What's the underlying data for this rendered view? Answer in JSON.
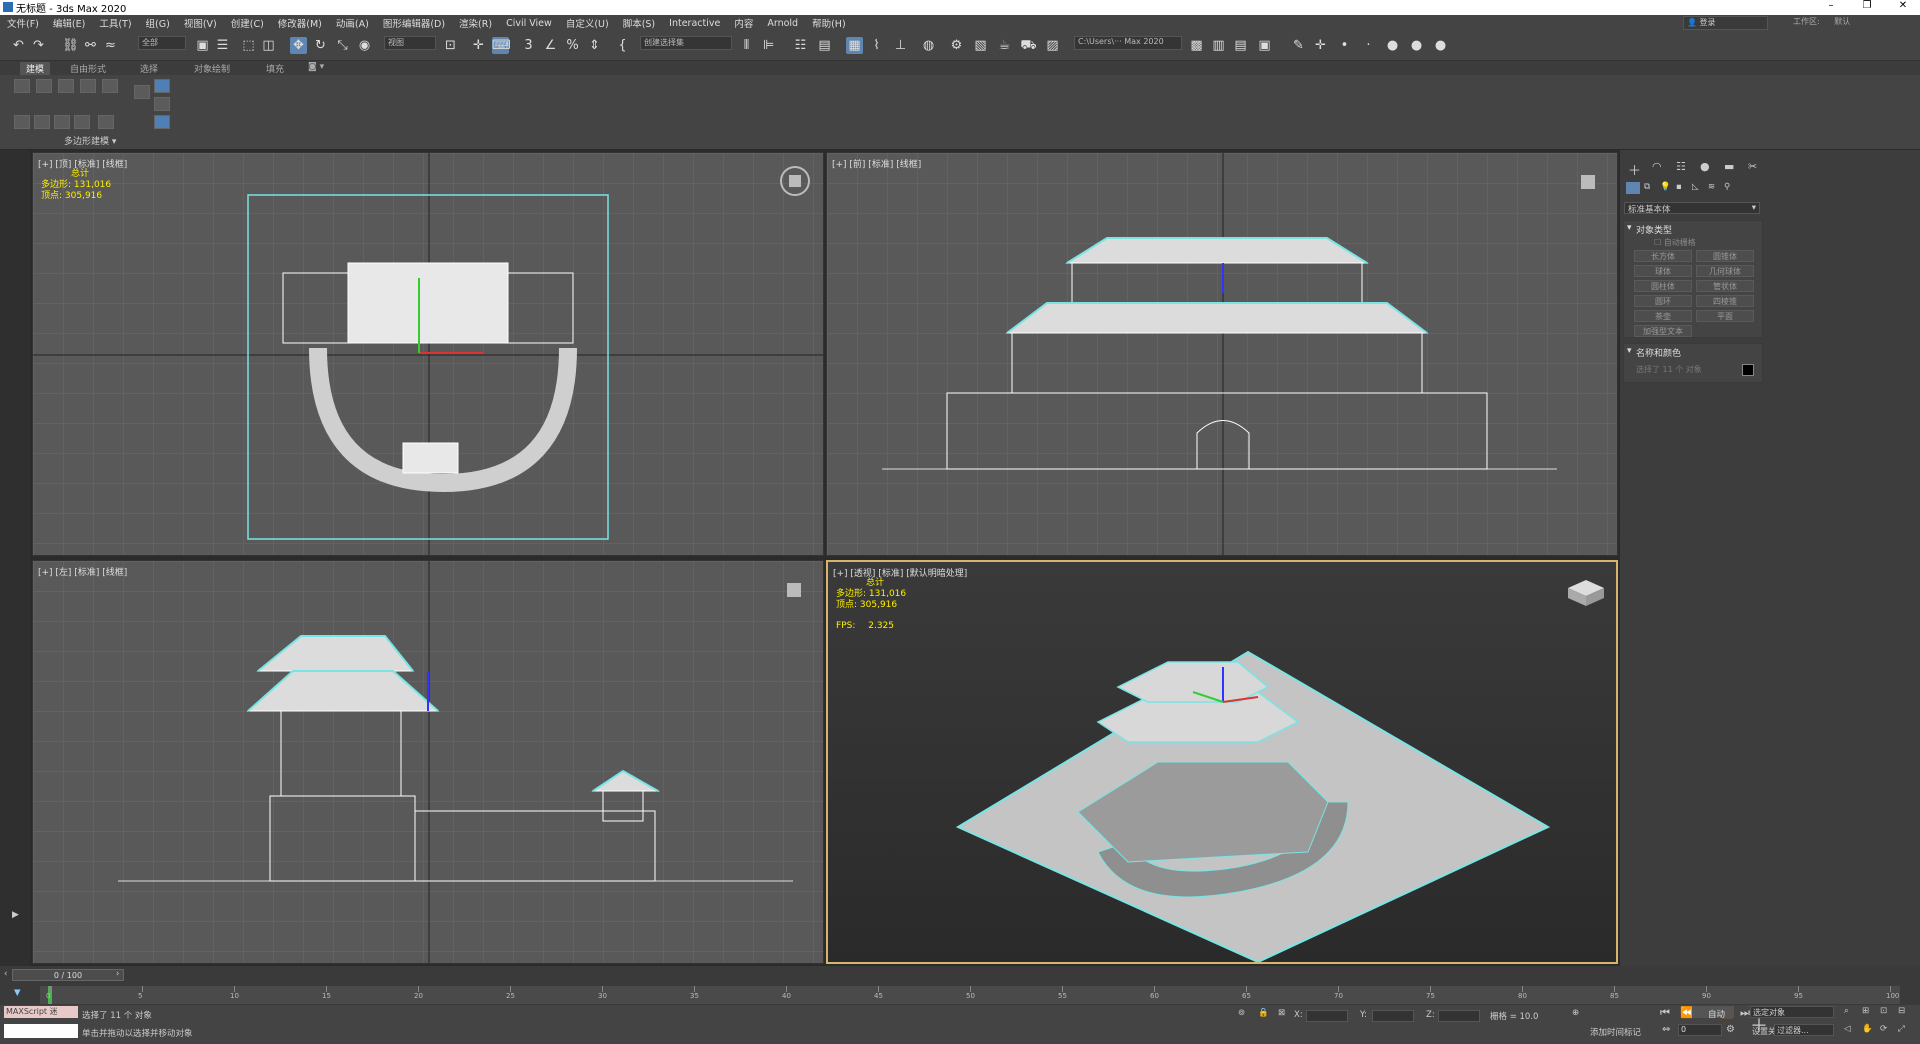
{
  "window": {
    "title": "无标题 - 3ds Max 2020"
  },
  "menus": [
    "文件(F)",
    "编辑(E)",
    "工具(T)",
    "组(G)",
    "视图(V)",
    "创建(C)",
    "修改器(M)",
    "动画(A)",
    "图形编辑器(D)",
    "渲染(R)",
    "Civil View",
    "自定义(U)",
    "脚本(S)",
    "Interactive",
    "内容",
    "Arnold",
    "帮助(H)"
  ],
  "account": {
    "login": "登录",
    "workspace_label": "工作区:",
    "workspace_value": "默认"
  },
  "toolbar": {
    "selection_filter": "全部",
    "ref_coord": "视图",
    "named_selection": "创建选择集",
    "project_path": "C:\\Users\\··· Max 2020"
  },
  "ribbon": {
    "tabs": [
      "建模",
      "自由形式",
      "选择",
      "对象绘制",
      "填充"
    ],
    "active_tab": "建模",
    "panel_label": "多边形建模 ▾"
  },
  "viewports": {
    "top": {
      "label": "[+] [顶] [标准] [线框]",
      "stats_title": "总计",
      "polys_label": "多边形:",
      "polys": "131,016",
      "verts_label": "顶点:",
      "verts": "305,916"
    },
    "front": {
      "label": "[+] [前] [标准] [线框]"
    },
    "left": {
      "label": "[+] [左] [标准] [线框]"
    },
    "perspective": {
      "label": "[+] [透视] [标准] [默认明暗处理]",
      "stats_title": "总计",
      "polys_label": "多边形:",
      "polys": "131,016",
      "verts_label": "顶点:",
      "verts": "305,916",
      "fps_label": "FPS:",
      "fps": "2.325"
    }
  },
  "command_panel": {
    "category_dropdown": "标准基本体",
    "object_type_title": "对象类型",
    "autogrid": "自动栅格",
    "buttons": [
      "长方体",
      "圆锥体",
      "球体",
      "几何球体",
      "圆柱体",
      "管状体",
      "圆环",
      "四棱锥",
      "茶壶",
      "平面",
      "加强型文本"
    ],
    "name_color_title": "名称和颜色",
    "name_placeholder": "选择了 11 个 对象",
    "object_color": "#000000"
  },
  "timeline": {
    "frame_display": "0 / 100",
    "ticks": [
      "0",
      "5",
      "10",
      "15",
      "20",
      "25",
      "30",
      "35",
      "40",
      "45",
      "50",
      "55",
      "60",
      "65",
      "70",
      "75",
      "80",
      "85",
      "90",
      "95",
      "100"
    ]
  },
  "status": {
    "maxscript_label": "MAXScript 迷",
    "selected_text": "选择了 11 个 对象",
    "prompt": "单击并拖动以选择并移动对象",
    "x_label": "X:",
    "y_label": "Y:",
    "z_label": "Z:",
    "grid": "栅格 = 10.0",
    "auto_key": "自动",
    "selected_object": "选定对象",
    "set_key": "设置关键点",
    "key_filters": "过滤器...",
    "add_time_tag": "添加时间标记",
    "frame_value": "0"
  },
  "colors": {
    "accent_blue": "#5f86b0",
    "selection_cyan": "#79e4e4",
    "active_border": "#d6b46a",
    "stats_yellow": "#ffef00"
  }
}
